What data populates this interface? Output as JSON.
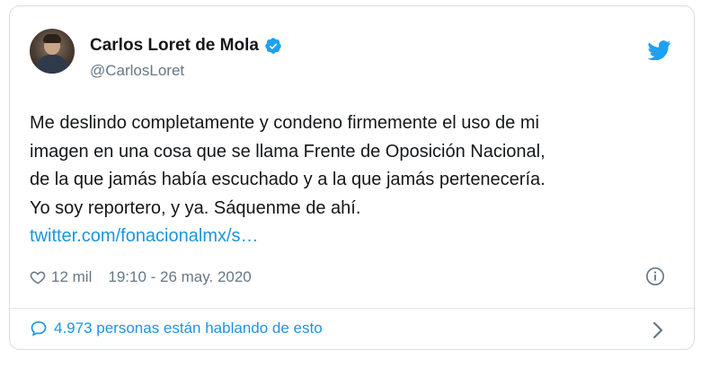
{
  "tweet": {
    "author": {
      "name": "Carlos Loret de Mola",
      "handle": "@CarlosLoret",
      "verified": true
    },
    "text_lines": [
      "Me deslindo completamente y condeno firmemente el uso de mi",
      "imagen en una cosa que se llama Frente de Oposición Nacional,",
      "de la que jamás había escuchado y a la que jamás pertenecería.",
      "Yo soy reportero, y ya. Sáquenme de ahí."
    ],
    "link": "twitter.com/fonacionalmx/s…",
    "likes": "12 mil",
    "timestamp": "19:10 - 26 may. 2020",
    "talking": "4.973 personas están hablando de esto"
  },
  "colors": {
    "accent": "#1b95e0",
    "muted": "#657786",
    "border": "#d6dde3"
  },
  "icons": [
    "verified-badge-icon",
    "twitter-bird-icon",
    "heart-icon",
    "info-icon",
    "speech-bubble-icon",
    "chevron-right-icon"
  ]
}
